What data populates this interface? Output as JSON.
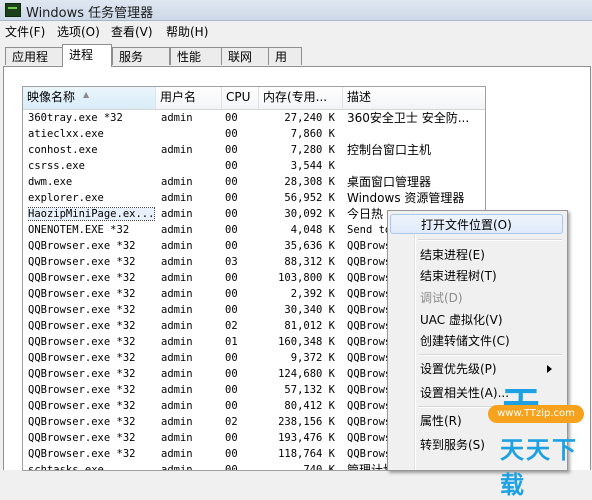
{
  "window": {
    "title": "Windows 任务管理器",
    "icon": "task-manager-icon"
  },
  "menubar": [
    "文件(F)",
    "选项(O)",
    "查看(V)",
    "帮助(H)"
  ],
  "tabs": [
    "应用程序",
    "进程",
    "服务",
    "性能",
    "联网",
    "用户"
  ],
  "active_tab": "进程",
  "columns": [
    "映像名称",
    "用户名",
    "CPU",
    "内存(专用...",
    "描述"
  ],
  "sorted_column": "映像名称",
  "processes": [
    {
      "name": "360tray.exe *32",
      "user": "admin",
      "cpu": "00",
      "mem": "27,240 K",
      "desc": "360安全卫士 安全防..."
    },
    {
      "name": "atieclxx.exe",
      "user": "",
      "cpu": "00",
      "mem": "7,860 K",
      "desc": ""
    },
    {
      "name": "conhost.exe",
      "user": "admin",
      "cpu": "00",
      "mem": "7,280 K",
      "desc": "控制台窗口主机"
    },
    {
      "name": "csrss.exe",
      "user": "",
      "cpu": "00",
      "mem": "3,544 K",
      "desc": ""
    },
    {
      "name": "dwm.exe",
      "user": "admin",
      "cpu": "00",
      "mem": "28,308 K",
      "desc": "桌面窗口管理器"
    },
    {
      "name": "explorer.exe",
      "user": "admin",
      "cpu": "00",
      "mem": "56,952 K",
      "desc": "Windows 资源管理器"
    },
    {
      "name": "HaozipMiniPage.ex...",
      "user": "admin",
      "cpu": "00",
      "mem": "30,092 K",
      "desc": "今日热"
    },
    {
      "name": "ONENOTEM.EXE *32",
      "user": "admin",
      "cpu": "00",
      "mem": "4,048 K",
      "desc": "Send to"
    },
    {
      "name": "QQBrowser.exe *32",
      "user": "admin",
      "cpu": "00",
      "mem": "35,636 K",
      "desc": "QQBrows"
    },
    {
      "name": "QQBrowser.exe *32",
      "user": "admin",
      "cpu": "03",
      "mem": "88,312 K",
      "desc": "QQBrows"
    },
    {
      "name": "QQBrowser.exe *32",
      "user": "admin",
      "cpu": "00",
      "mem": "103,800 K",
      "desc": "QQBrows"
    },
    {
      "name": "QQBrowser.exe *32",
      "user": "admin",
      "cpu": "00",
      "mem": "2,392 K",
      "desc": "QQBrows"
    },
    {
      "name": "QQBrowser.exe *32",
      "user": "admin",
      "cpu": "00",
      "mem": "30,340 K",
      "desc": "QQBrows"
    },
    {
      "name": "QQBrowser.exe *32",
      "user": "admin",
      "cpu": "02",
      "mem": "81,012 K",
      "desc": "QQBrows"
    },
    {
      "name": "QQBrowser.exe *32",
      "user": "admin",
      "cpu": "01",
      "mem": "160,348 K",
      "desc": "QQBrows"
    },
    {
      "name": "QQBrowser.exe *32",
      "user": "admin",
      "cpu": "00",
      "mem": "9,372 K",
      "desc": "QQBrows"
    },
    {
      "name": "QQBrowser.exe *32",
      "user": "admin",
      "cpu": "00",
      "mem": "124,680 K",
      "desc": "QQBrows"
    },
    {
      "name": "QQBrowser.exe *32",
      "user": "admin",
      "cpu": "00",
      "mem": "57,132 K",
      "desc": "QQBrows"
    },
    {
      "name": "QQBrowser.exe *32",
      "user": "admin",
      "cpu": "00",
      "mem": "80,412 K",
      "desc": "QQBrows"
    },
    {
      "name": "QQBrowser.exe *32",
      "user": "admin",
      "cpu": "02",
      "mem": "238,156 K",
      "desc": "QQBrows"
    },
    {
      "name": "QQBrowser.exe *32",
      "user": "admin",
      "cpu": "00",
      "mem": "193,476 K",
      "desc": "QQBrows"
    },
    {
      "name": "QQBrowser.exe *32",
      "user": "admin",
      "cpu": "00",
      "mem": "118,764 K",
      "desc": "QQBrows"
    },
    {
      "name": "schtasks.exe",
      "user": "admin",
      "cpu": "00",
      "mem": "740 K",
      "desc": "管理计划任务"
    }
  ],
  "selected_row": 6,
  "context_menu": [
    {
      "label": "打开文件位置(O)",
      "state": "hot"
    },
    {
      "sep": true
    },
    {
      "label": "结束进程(E)"
    },
    {
      "label": "结束进程树(T)"
    },
    {
      "label": "调试(D)",
      "state": "disabled"
    },
    {
      "label": "UAC 虚拟化(V)"
    },
    {
      "label": "创建转储文件(C)"
    },
    {
      "sep": true
    },
    {
      "label": "设置优先级(P)",
      "submenu": true
    },
    {
      "label": "设置相关性(A)..."
    },
    {
      "sep": true
    },
    {
      "label": "属性(R)"
    },
    {
      "label": "转到服务(S)"
    }
  ],
  "watermark": {
    "logo": "天",
    "url": "www.TTzip.com",
    "brand": "天天下载"
  },
  "colors": {
    "accent": "#1da1e2",
    "watermark_orange": "#f6a21d",
    "hover": "#dfeafa"
  }
}
